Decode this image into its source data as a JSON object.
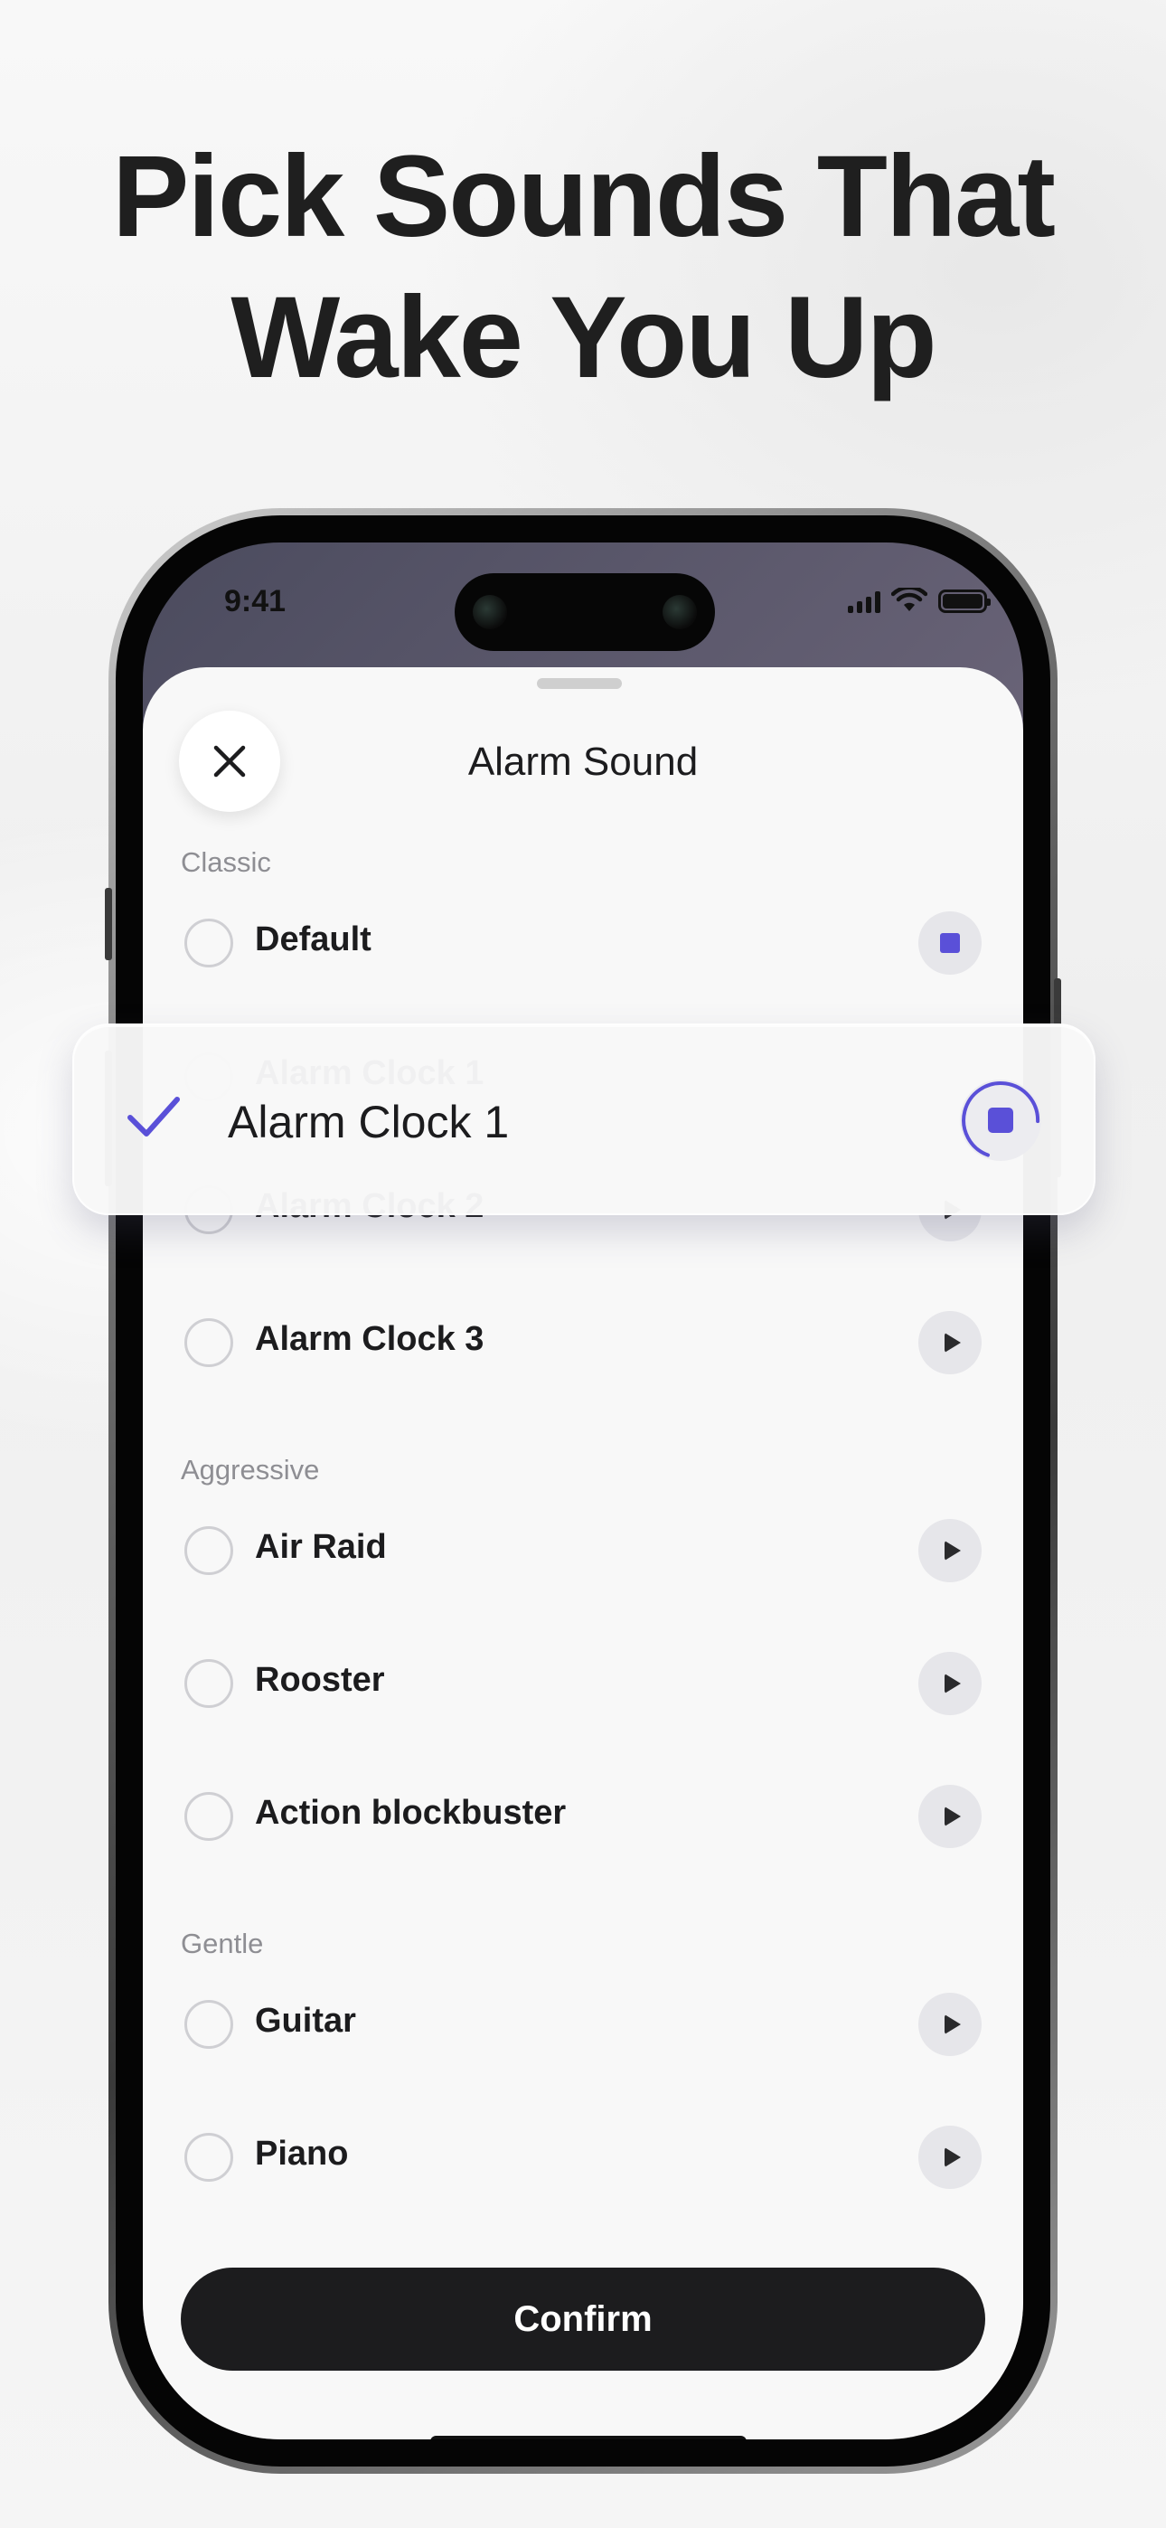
{
  "headline": {
    "line1": "Pick Sounds That",
    "line2": "Wake You Up"
  },
  "status_bar": {
    "time": "9:41"
  },
  "sheet": {
    "title": "Alarm Sound",
    "confirm_label": "Confirm"
  },
  "sections": [
    {
      "label": "Classic"
    },
    {
      "label": "Aggressive"
    },
    {
      "label": "Gentle"
    }
  ],
  "sounds": [
    {
      "label": "Default",
      "section": "Classic",
      "state": "playing"
    },
    {
      "label": "Alarm Clock 1",
      "section": "Classic",
      "state": "selected-playing"
    },
    {
      "label": "Alarm Clock 2",
      "section": "Classic",
      "state": "idle"
    },
    {
      "label": "Alarm Clock 3",
      "section": "Classic",
      "state": "idle"
    },
    {
      "label": "Air Raid",
      "section": "Aggressive",
      "state": "idle"
    },
    {
      "label": "Rooster",
      "section": "Aggressive",
      "state": "idle"
    },
    {
      "label": "Action blockbuster",
      "section": "Aggressive",
      "state": "idle"
    },
    {
      "label": "Guitar",
      "section": "Gentle",
      "state": "idle"
    },
    {
      "label": "Piano",
      "section": "Gentle",
      "state": "idle"
    }
  ],
  "colors": {
    "accent": "#5a50d8",
    "button_dark": "#1c1c1e",
    "secondary_text": "#8e8e93"
  },
  "icons": {
    "close": "close-icon",
    "play": "play-icon",
    "stop": "stop-icon",
    "check": "checkmark-icon"
  }
}
